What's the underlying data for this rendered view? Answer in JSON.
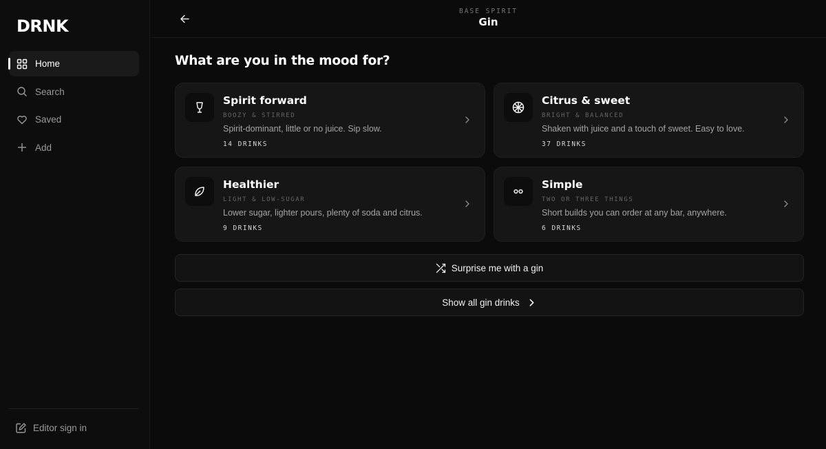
{
  "app": {
    "logo": "DRNK"
  },
  "sidebar": {
    "items": [
      {
        "label": "Home",
        "icon": "grid-icon",
        "active": true
      },
      {
        "label": "Search",
        "icon": "search-icon",
        "active": false
      },
      {
        "label": "Saved",
        "icon": "heart-icon",
        "active": false
      },
      {
        "label": "Add",
        "icon": "plus-icon",
        "active": false
      }
    ],
    "editor_label": "Editor sign in"
  },
  "header": {
    "eyebrow": "BASE SPIRIT",
    "title": "Gin"
  },
  "main": {
    "title": "What are you in the mood for?",
    "cards": [
      {
        "title": "Spirit forward",
        "subtitle": "BOOZY & STIRRED",
        "description": "Spirit-dominant, little or no juice. Sip slow.",
        "count": "14 DRINKS",
        "icon": "cocktail-glass-icon"
      },
      {
        "title": "Citrus & sweet",
        "subtitle": "BRIGHT & BALANCED",
        "description": "Shaken with juice and a touch of sweet. Easy to love.",
        "count": "37 DRINKS",
        "icon": "citrus-slice-icon"
      },
      {
        "title": "Healthier",
        "subtitle": "LIGHT & LOW-SUGAR",
        "description": "Lower sugar, lighter pours, plenty of soda and citrus.",
        "count": "9 DRINKS",
        "icon": "leaf-icon"
      },
      {
        "title": "Simple",
        "subtitle": "TWO OR THREE THINGS",
        "description": "Short builds you can order at any bar, anywhere.",
        "count": "6 DRINKS",
        "icon": "two-dots-icon"
      }
    ],
    "surprise_label": "Surprise me with a gin",
    "show_all_label": "Show all gin drinks"
  },
  "colors": {
    "background": "#0b0b0b",
    "card": "#161616",
    "text": "#ffffff",
    "muted": "#a5a5a5"
  }
}
